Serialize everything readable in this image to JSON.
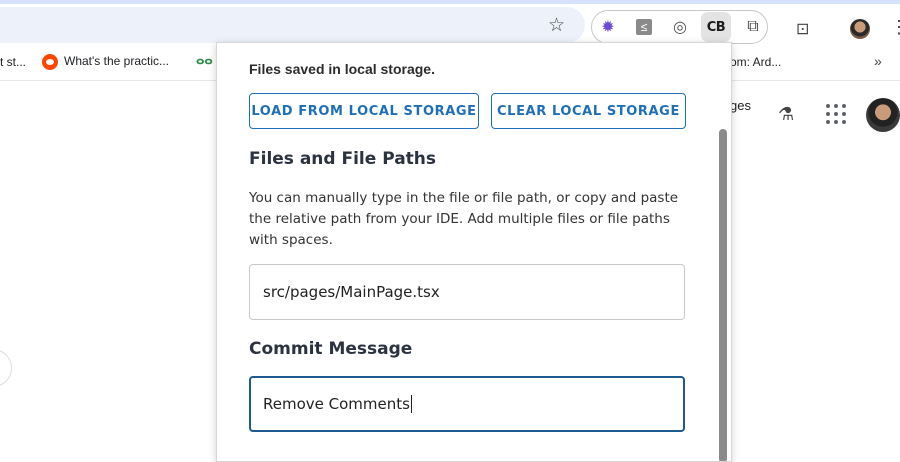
{
  "browser": {
    "extensions": [
      "gear-extension-icon",
      "s-extension-icon",
      "eye-extension-icon",
      "cb-extension-icon",
      "puzzle-icon"
    ],
    "cb_label": "CB"
  },
  "bookmarks": [
    {
      "label": "t st..."
    },
    {
      "label": "What's the practic..."
    },
    {
      "label": "gfg-logo"
    },
    {
      "label": "om: Ard..."
    }
  ],
  "page_bg": {
    "partial_text": "ges"
  },
  "popup": {
    "saved_note": "Files saved in local storage.",
    "load_button": "LOAD FROM LOCAL STORAGE",
    "clear_button": "CLEAR LOCAL STORAGE",
    "files_heading": "Files and File Paths",
    "files_description": "You can manually type in the file or file path, or copy and paste the relative path from your IDE. Add multiple files or file paths with spaces.",
    "files_value": "src/pages/MainPage.tsx",
    "commit_heading": "Commit Message",
    "commit_value": "Remove Comments"
  },
  "colors": {
    "accent": "#1f6fb8",
    "focus_border": "#1f5a8f",
    "omnibox_bg": "#edf2fa"
  }
}
